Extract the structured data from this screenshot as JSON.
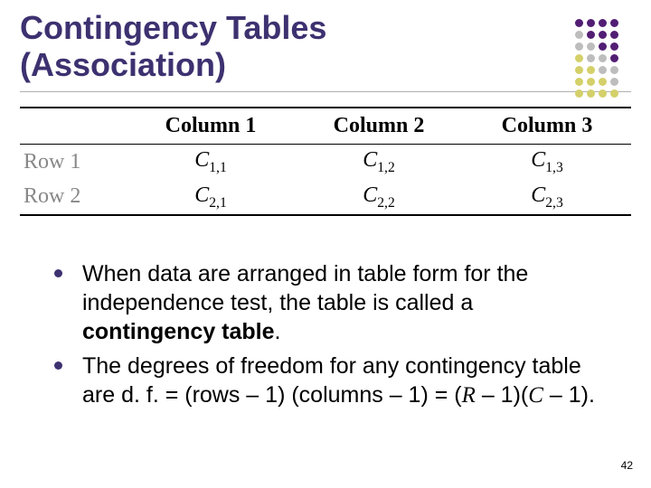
{
  "title_line1": "Contingency Tables",
  "title_line2": "(Association)",
  "decor": {
    "rows": [
      [
        "#521e74",
        "#521e74",
        "#521e74",
        "#521e74"
      ],
      [
        "#bdbdbd",
        "#521e74",
        "#521e74",
        "#521e74"
      ],
      [
        "#bdbdbd",
        "#bdbdbd",
        "#521e74",
        "#521e74"
      ],
      [
        "#d4d06a",
        "#bdbdbd",
        "#bdbdbd",
        "#521e74"
      ],
      [
        "#d4d06a",
        "#d4d06a",
        "#bdbdbd",
        "#bdbdbd"
      ],
      [
        "#d4d06a",
        "#d4d06a",
        "#d4d06a",
        "#bdbdbd"
      ],
      [
        "#d4d06a",
        "#d4d06a",
        "#d4d06a",
        "#d4d06a"
      ]
    ]
  },
  "table": {
    "headers": [
      "Column 1",
      "Column 2",
      "Column 3"
    ],
    "rowLabels": [
      "Row 1",
      "Row 2"
    ],
    "cells": [
      [
        "C₁,₁",
        "C₁,₂",
        "C₁,₃"
      ],
      [
        "C₂,₁",
        "C₂,₂",
        "C₂,₃"
      ]
    ]
  },
  "bullets": {
    "b1_pre": "When data are arranged in table form for the independence test, the table is called a ",
    "b1_bold": "contingency table",
    "b1_post": ".",
    "b2_a": "The degrees of freedom for any contingency table are d. f. = (rows – 1) (columns – 1) = (",
    "b2_R": "R",
    "b2_mid": " – 1)(",
    "b2_C": "C",
    "b2_end": " – 1)."
  },
  "page": "42",
  "chart_data": {
    "type": "table",
    "title": "Contingency table layout",
    "columns": [
      "Column 1",
      "Column 2",
      "Column 3"
    ],
    "rows": [
      "Row 1",
      "Row 2"
    ],
    "cells": [
      [
        "C1,1",
        "C1,2",
        "C1,3"
      ],
      [
        "C2,1",
        "C2,2",
        "C2,3"
      ]
    ],
    "formula": "d.f. = (rows - 1)(columns - 1) = (R - 1)(C - 1)"
  }
}
